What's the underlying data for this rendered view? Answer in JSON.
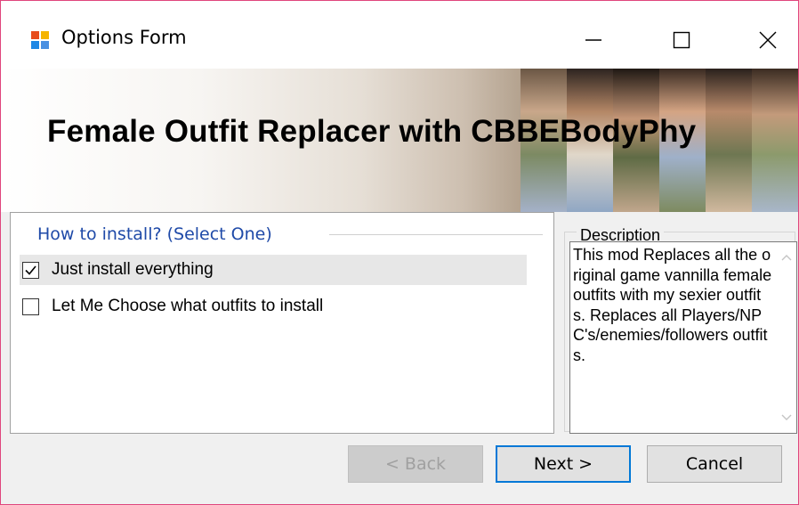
{
  "window": {
    "title": "Options Form",
    "icon": "app-window-icon",
    "controls": {
      "minimize": "minimize-icon",
      "maximize": "maximize-icon",
      "close": "close-icon"
    }
  },
  "banner": {
    "title": "Female Outfit Replacer with CBBEBodyPhy"
  },
  "install_group": {
    "header": "How to install? (Select One)",
    "options": [
      {
        "label": "Just install everything",
        "checked": true,
        "selected": true
      },
      {
        "label": "Let Me Choose what outfits to install",
        "checked": false,
        "selected": false
      }
    ]
  },
  "description": {
    "title": "Description",
    "text": "This mod Replaces all the original game vannilla female outfits with my sexier outfits. Replaces all Players/NPC's/enemies/followers outfits."
  },
  "buttons": {
    "back": "< Back",
    "next": "Next >",
    "cancel": "Cancel"
  },
  "colors": {
    "accent": "#0078d7",
    "window_border": "#e0467d",
    "group_header": "#1f4aa8"
  }
}
